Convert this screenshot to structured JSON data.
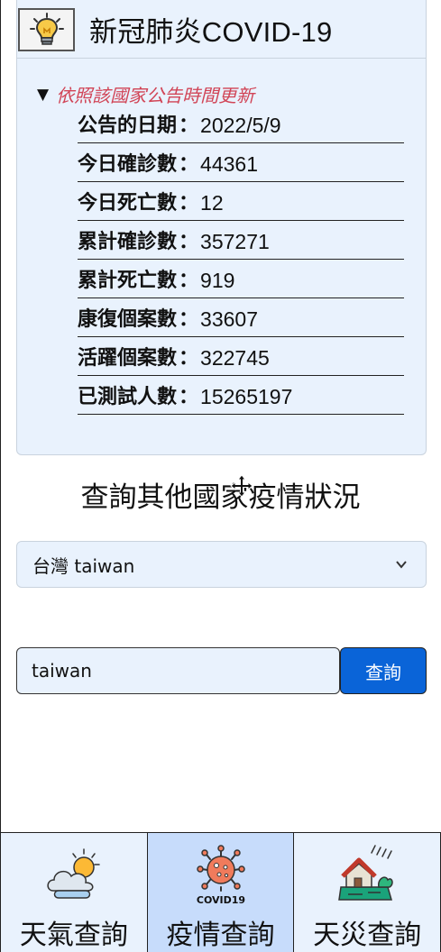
{
  "header": {
    "title": "新冠肺炎COVID-19",
    "logo_icon": "lightbulb-icon"
  },
  "summary": {
    "label": "依照該國家公告時間更新",
    "color": "#d14456"
  },
  "stats": [
    {
      "label": "公告的日期",
      "value": "2022/5/9"
    },
    {
      "label": "今日確診數",
      "value": "44361"
    },
    {
      "label": "今日死亡數",
      "value": "12"
    },
    {
      "label": "累計確診數",
      "value": "357271"
    },
    {
      "label": "累計死亡數",
      "value": "919"
    },
    {
      "label": "康復個案數",
      "value": "33607"
    },
    {
      "label": "活躍個案數",
      "value": "322745"
    },
    {
      "label": "已測試人數",
      "value": "15265197"
    }
  ],
  "separator": "：",
  "query": {
    "title": "查詢其他國家疫情狀況",
    "select_value": "台灣 taiwan",
    "input_value": "taiwan",
    "button_label": "查詢"
  },
  "nav": [
    {
      "label": "天氣查詢",
      "icon": "weather-icon",
      "active": false
    },
    {
      "label": "疫情查詢",
      "icon": "virus-icon",
      "active": true
    },
    {
      "label": "天災查詢",
      "icon": "disaster-icon",
      "active": false
    }
  ],
  "nav_virus_icon_text": "COVID19",
  "colors": {
    "accent": "#0a64d8",
    "card_bg": "#e9f2fd",
    "active_nav": "#c7dcfb"
  }
}
